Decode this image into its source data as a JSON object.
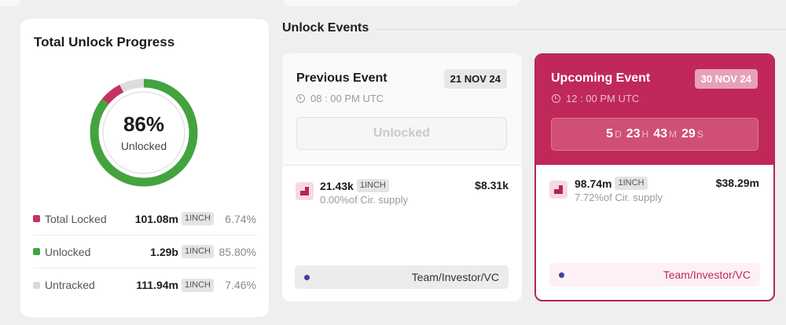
{
  "progress": {
    "title": "Total Unlock Progress",
    "percent_text": "86%",
    "percent_value": 86,
    "center_label": "Unlocked",
    "segments": [
      {
        "name": "Unlocked",
        "fraction": 0.858,
        "color": "#44a33f"
      },
      {
        "name": "Total Locked",
        "fraction": 0.0674,
        "color": "#c4345f"
      },
      {
        "name": "Untracked",
        "fraction": 0.0746,
        "color": "#dcdcdc"
      }
    ],
    "legend": [
      {
        "name": "Total Locked",
        "amount": "101.08m",
        "token": "1INCH",
        "pct": "6.74%",
        "color": "#c4345f"
      },
      {
        "name": "Unlocked",
        "amount": "1.29b",
        "token": "1INCH",
        "pct": "85.80%",
        "color": "#44a33f"
      },
      {
        "name": "Untracked",
        "amount": "111.94m",
        "token": "1INCH",
        "pct": "7.46%",
        "color": "#d9d9d9"
      }
    ]
  },
  "section_title": "Unlock Events",
  "previous": {
    "title": "Previous Event",
    "date": "21 NOV 24",
    "time": "08 : 00 PM UTC",
    "button_label": "Unlocked",
    "token_amount": "21.43k",
    "token": "1INCH",
    "usd_value": "$8.31k",
    "supply": "0.00%of Cir. supply",
    "category": "Team/Investor/VC"
  },
  "upcoming": {
    "title": "Upcoming Event",
    "date": "30 NOV 24",
    "time": "12 : 00 PM UTC",
    "countdown": {
      "d": "5",
      "d_unit": "D",
      "h": "23",
      "h_unit": "H",
      "m": "43",
      "m_unit": "M",
      "s": "29",
      "s_unit": "S"
    },
    "token_amount": "98.74m",
    "token": "1INCH",
    "usd_value": "$38.29m",
    "supply": "7.72%of Cir. supply",
    "category": "Team/Investor/VC"
  },
  "colors": {
    "accent": "#c0285a",
    "unlocked": "#44a33f",
    "locked": "#c4345f",
    "category_dot": "#3b3fa8"
  },
  "icons": {
    "clock": "clock-icon",
    "token": "1inch-token-icon"
  }
}
